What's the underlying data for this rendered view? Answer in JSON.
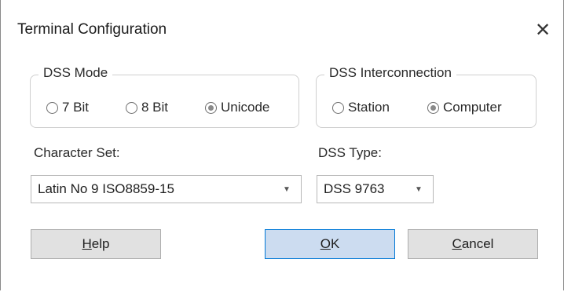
{
  "dialog": {
    "title": "Terminal Configuration",
    "close_icon": "close-icon"
  },
  "dss_mode": {
    "legend": "DSS Mode",
    "options": [
      {
        "label": "7 Bit",
        "selected": false
      },
      {
        "label": "8 Bit",
        "selected": false
      },
      {
        "label": "Unicode",
        "selected": true
      }
    ]
  },
  "dss_interconnection": {
    "legend": "DSS Interconnection",
    "options": [
      {
        "label": "Station",
        "selected": false
      },
      {
        "label": "Computer",
        "selected": true
      }
    ]
  },
  "character_set": {
    "label": "Character Set:",
    "value": "Latin No 9  ISO8859-15"
  },
  "dss_type": {
    "label": "DSS Type:",
    "value": "DSS 9763"
  },
  "buttons": {
    "help_mnemonic": "H",
    "help_rest": "elp",
    "ok_mnemonic": "O",
    "ok_rest": "K",
    "cancel_mnemonic": "C",
    "cancel_rest": "ancel"
  }
}
